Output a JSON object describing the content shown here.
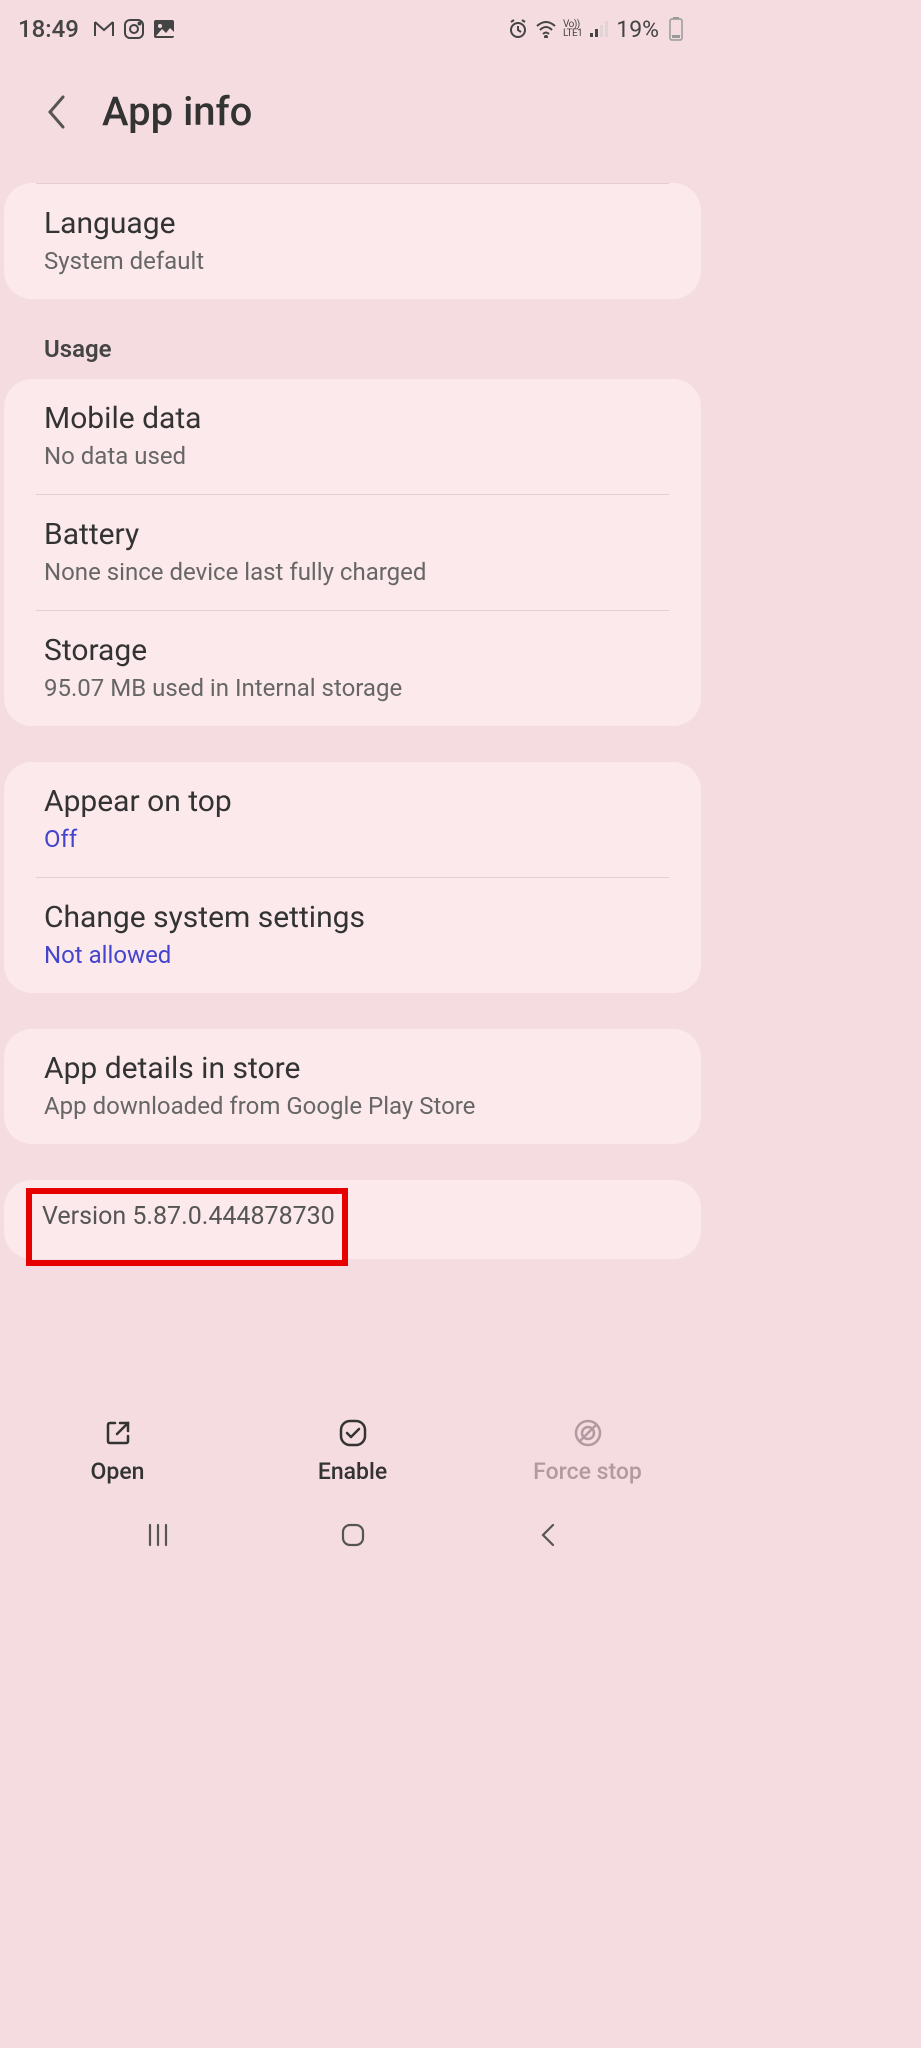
{
  "status": {
    "time": "18:49",
    "battery": "19%",
    "lte_top": "Vo))",
    "lte_bottom": "LTE1"
  },
  "header": {
    "title": "App info"
  },
  "sections": {
    "language": {
      "title": "Language",
      "value": "System default"
    },
    "usage_label": "Usage",
    "mobile_data": {
      "title": "Mobile data",
      "value": "No data used"
    },
    "battery": {
      "title": "Battery",
      "value": "None since device last fully charged"
    },
    "storage": {
      "title": "Storage",
      "value": "95.07 MB used in Internal storage"
    },
    "appear_on_top": {
      "title": "Appear on top",
      "value": "Off"
    },
    "change_system": {
      "title": "Change system settings",
      "value": "Not allowed"
    },
    "app_details": {
      "title": "App details in store",
      "value": "App downloaded from Google Play Store"
    },
    "version": "Version 5.87.0.444878730"
  },
  "actions": {
    "open": "Open",
    "enable": "Enable",
    "force_stop": "Force stop"
  }
}
